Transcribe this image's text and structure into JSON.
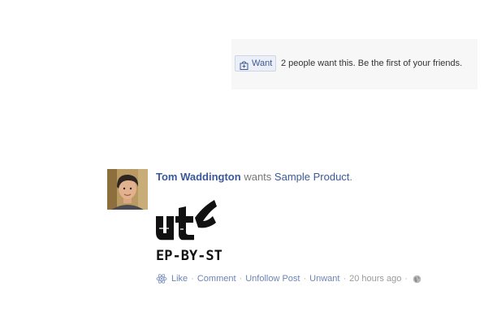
{
  "want_widget": {
    "button_label": "Want",
    "button_icon": "bag-icon",
    "summary_text": "2 people want this. Be the first of your friends."
  },
  "story": {
    "actor": "Tom Waddington",
    "verb": "wants",
    "object": "Sample Product",
    "object_punctuation": ".",
    "product_image_text": "EP-BY-ST",
    "actions": {
      "like": "Like",
      "comment": "Comment",
      "unfollow": "Unfollow Post",
      "unwant": "Unwant",
      "timestamp": "20 hours ago",
      "separator": "·",
      "like_icon": "like-icon",
      "privacy_icon": "globe-icon"
    }
  },
  "colors": {
    "link": "#3b5998",
    "muted_link": "#6d84b4",
    "muted_text": "#999999",
    "widget_bg": "#f7f7f7"
  }
}
